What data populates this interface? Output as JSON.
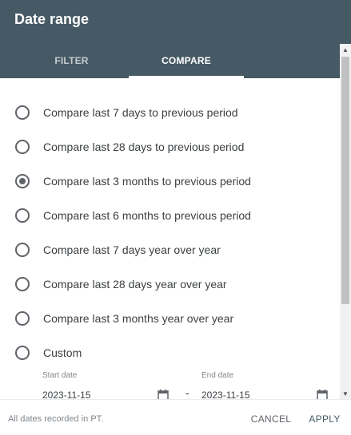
{
  "dialog": {
    "title": "Date range",
    "tabs": [
      {
        "label": "FILTER",
        "active": false
      },
      {
        "label": "COMPARE",
        "active": true
      }
    ]
  },
  "options": [
    {
      "label": "Compare last 7 days to previous period",
      "checked": false
    },
    {
      "label": "Compare last 28 days to previous period",
      "checked": false
    },
    {
      "label": "Compare last 3 months to previous period",
      "checked": true
    },
    {
      "label": "Compare last 6 months to previous period",
      "checked": false
    },
    {
      "label": "Compare last 7 days year over year",
      "checked": false
    },
    {
      "label": "Compare last 28 days year over year",
      "checked": false
    },
    {
      "label": "Compare last 3 months year over year",
      "checked": false
    },
    {
      "label": "Custom",
      "checked": false
    }
  ],
  "custom_range": {
    "start_label": "Start date",
    "start_value": "2023-11-15",
    "separator": "-",
    "end_label": "End date",
    "end_value": "2023-11-15"
  },
  "footer": {
    "note": "All dates recorded in PT.",
    "cancel_label": "CANCEL",
    "apply_label": "APPLY"
  },
  "colors": {
    "header": "#455a64",
    "radio": "#5f6368"
  },
  "icons": {
    "calendar": "calendar-icon",
    "scroll_up": "scroll-up-arrow",
    "scroll_down": "scroll-down-arrow"
  }
}
